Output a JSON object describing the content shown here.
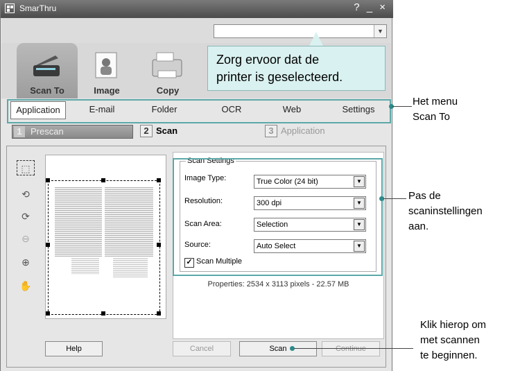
{
  "window": {
    "title": "SmarThru",
    "help_icon": "?",
    "minimize": "_",
    "close": "×"
  },
  "mode_tabs": [
    {
      "label": "Scan To"
    },
    {
      "label": "Image"
    },
    {
      "label": "Copy"
    }
  ],
  "tooltip": {
    "line1": "Zorg ervoor dat de",
    "line2": "printer is geselecteerd."
  },
  "subnav": [
    "Application",
    "E-mail",
    "Folder",
    "OCR",
    "Web",
    "Settings"
  ],
  "steps": {
    "prescan": "Prescan",
    "prescan_num": "1",
    "scan": "Scan",
    "scan_num": "2",
    "application": "Application",
    "application_num": "3"
  },
  "scan_settings": {
    "legend": "Scan Settings",
    "image_type_label": "Image Type:",
    "image_type": "True Color (24 bit)",
    "resolution_label": "Resolution:",
    "resolution": "300 dpi",
    "scan_area_label": "Scan Area:",
    "scan_area": "Selection",
    "source_label": "Source:",
    "source": "Auto Select",
    "scan_multiple_label": "Scan Multiple",
    "scan_multiple_checked": true
  },
  "properties": "Properties: 2534 x 3113 pixels - 22.57 MB",
  "buttons": {
    "help": "Help",
    "cancel": "Cancel",
    "scan": "Scan",
    "continue": "Continue"
  },
  "annotations": {
    "menu": [
      "Het menu",
      "Scan To"
    ],
    "settings": [
      "Pas de",
      "scaninstellingen",
      "aan."
    ],
    "click": [
      "Klik hierop om",
      "met scannen",
      "te beginnen."
    ]
  },
  "colors": {
    "accent": "#2b8a8a",
    "highlight_border": "#5ba8a8",
    "tooltip_bg": "#d9f1f0"
  }
}
